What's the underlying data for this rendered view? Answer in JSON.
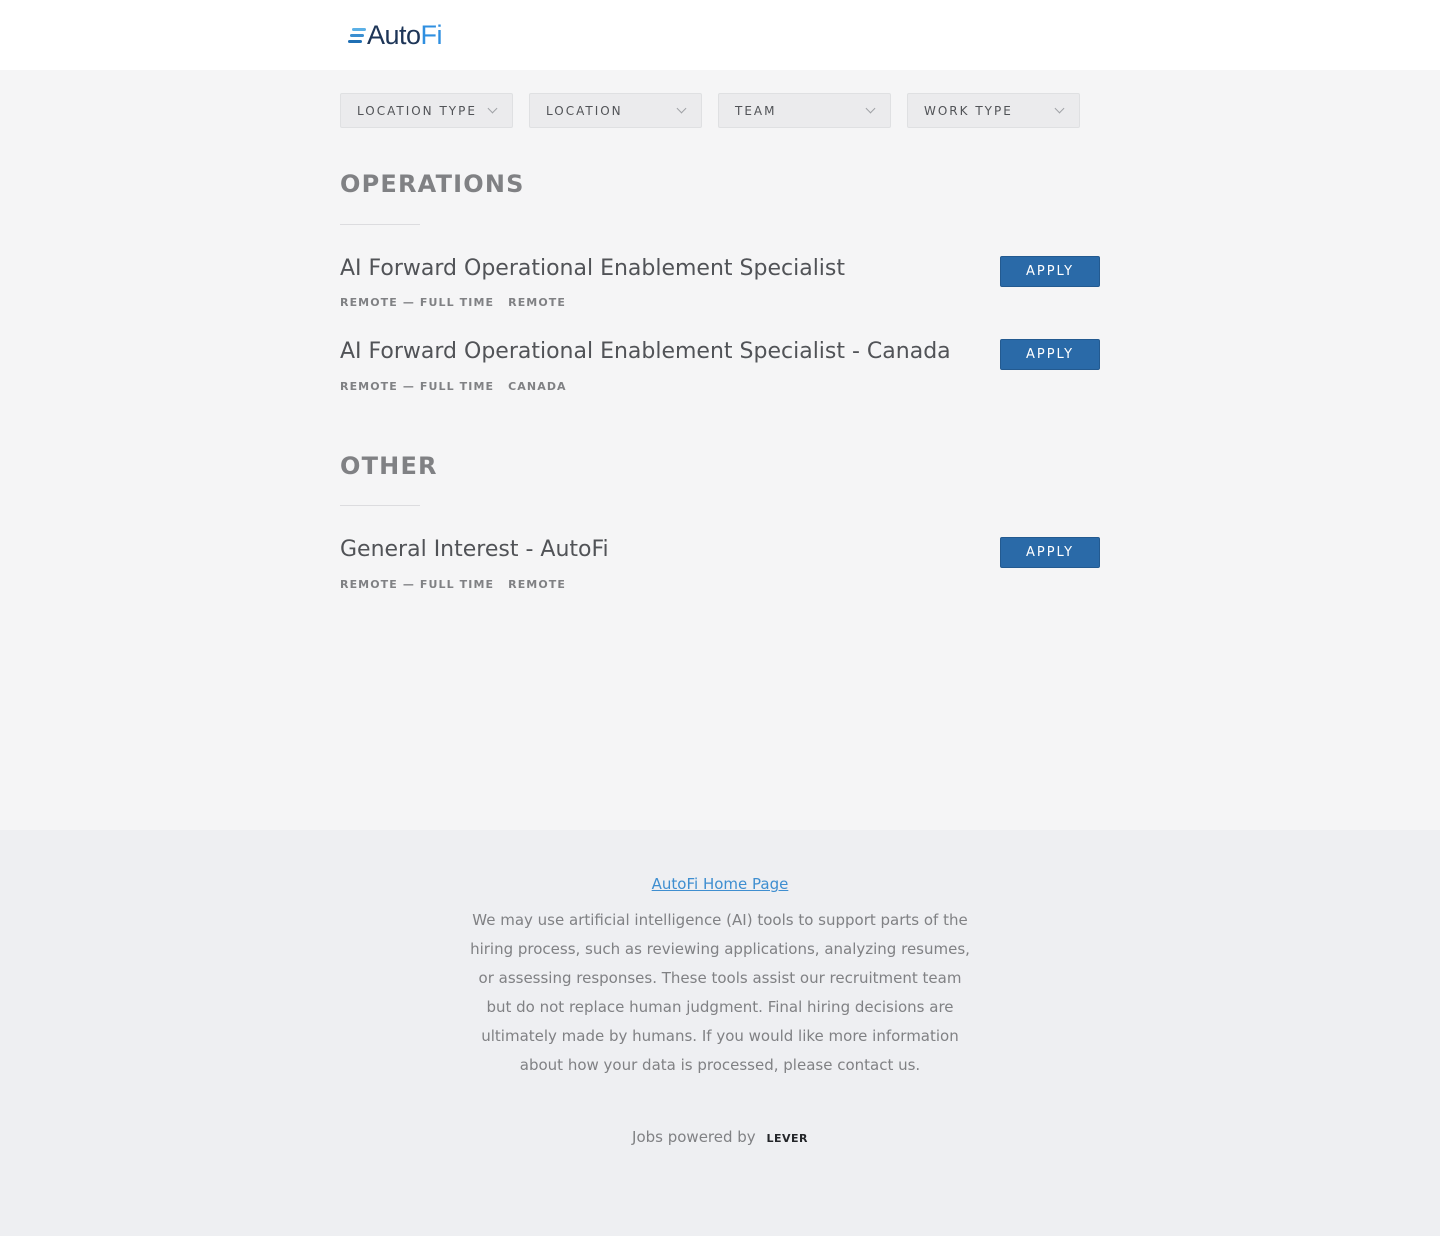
{
  "header": {
    "logo_text_auto": "Auto",
    "logo_text_fi": "Fi",
    "logo_icon": "autofi-lines-icon"
  },
  "filters": [
    {
      "label": "LOCATION TYPE"
    },
    {
      "label": "LOCATION"
    },
    {
      "label": "TEAM"
    },
    {
      "label": "WORK TYPE"
    }
  ],
  "sections": [
    {
      "title": "OPERATIONS",
      "postings": [
        {
          "title": "AI Forward Operational Enablement Specialist",
          "commitment": "REMOTE — FULL TIME",
          "location": "REMOTE",
          "apply_label": "APPLY"
        },
        {
          "title": "AI Forward Operational Enablement Specialist - Canada",
          "commitment": "REMOTE — FULL TIME",
          "location": "CANADA",
          "apply_label": "APPLY"
        }
      ]
    },
    {
      "title": "OTHER",
      "postings": [
        {
          "title": "General Interest - AutoFi",
          "commitment": "REMOTE — FULL TIME",
          "location": "REMOTE",
          "apply_label": "APPLY"
        }
      ]
    }
  ],
  "footer": {
    "home_link": "AutoFi Home Page",
    "disclaimer": "We may use artificial intelligence (AI) tools to support parts of the hiring process, such as reviewing applications, analyzing resumes, or assessing responses. These tools assist our recruitment team but do not replace human judgment. Final hiring decisions are ultimately made by humans. If you would like more information about how your data is processed, please contact us.",
    "powered_by": "Jobs powered by",
    "powered_brand": "LEVER"
  },
  "colors": {
    "accent": "#2a6aa8",
    "link": "#3e8ed0",
    "logo_dark": "#1d3557",
    "logo_light": "#2f8fe0"
  }
}
